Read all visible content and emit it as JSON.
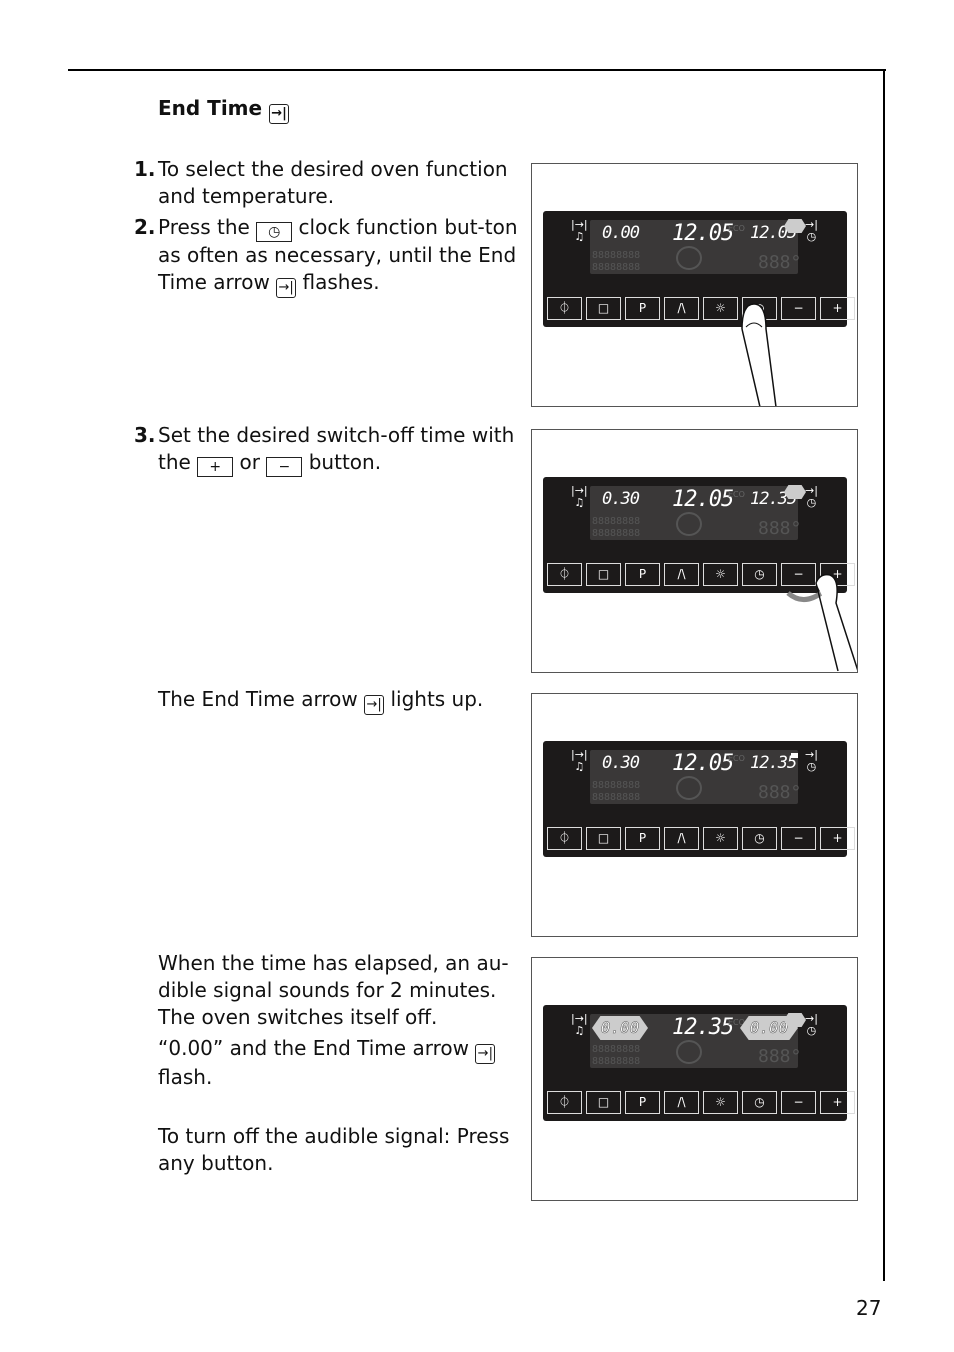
{
  "page": {
    "number": "27",
    "title": "End Time",
    "title_icon": "end-time-arrow-icon"
  },
  "steps": [
    {
      "num": "1.",
      "text": "To select the desired oven function and temperature."
    },
    {
      "num": "2.",
      "pre": "Press the",
      "icon": "clock-icon",
      "post": "clock function but-ton as often as necessary, until the End Time arrow",
      "icon2": "end-time-arrow-icon",
      "post2": "flashes."
    },
    {
      "num": "3.",
      "pre": "Set the desired switch-off time with the",
      "plus": "+",
      "mid": "or",
      "minus": "−",
      "post": "button."
    }
  ],
  "note_lights_up": {
    "pre": "The End Time arrow",
    "post": "lights up."
  },
  "elapsed": {
    "line1": "When the time has elapsed, an au-dible signal sounds for 2 minutes. The oven switches itself off.",
    "line2_pre": "“0.00” and the End Time arrow",
    "line2_post": "flash.",
    "line3": "To turn off the audible signal: Press any button."
  },
  "arrow_glyph": "→|",
  "clock_glyph": "◷",
  "panel_buttons": [
    {
      "name": "on-off-button",
      "glyph": "⏀"
    },
    {
      "name": "stop-button",
      "glyph": "□"
    },
    {
      "name": "program-button",
      "glyph": "P"
    },
    {
      "name": "function-button",
      "glyph": "/\\"
    },
    {
      "name": "light-button",
      "glyph": "☼"
    },
    {
      "name": "clock-button",
      "glyph": "◷"
    },
    {
      "name": "minus-button",
      "glyph": "−"
    },
    {
      "name": "plus-button",
      "glyph": "+"
    }
  ],
  "figures": [
    {
      "left": "0.00",
      "mid": "12.05",
      "right": "12.05",
      "state": "end-arrow-flashing",
      "gesture": "press clock button"
    },
    {
      "left": "0.30",
      "mid": "12.05",
      "right": "12.35",
      "state": "end-arrow-flashing",
      "gesture": "press plus or minus"
    },
    {
      "left": "0.30",
      "mid": "12.05",
      "right": "12.35",
      "state": "end-arrow-lit",
      "gesture": ""
    },
    {
      "left": "0.00",
      "mid": "12.35",
      "right": "0.00",
      "state": "0.00-and-arrow-flashing",
      "gesture": ""
    }
  ],
  "lcd_labels": {
    "eco": "ECO",
    "ghost_row": "88888888",
    "ghost_temp": "888°",
    "timer_icon": "|→|",
    "bell": "🔔︎"
  }
}
